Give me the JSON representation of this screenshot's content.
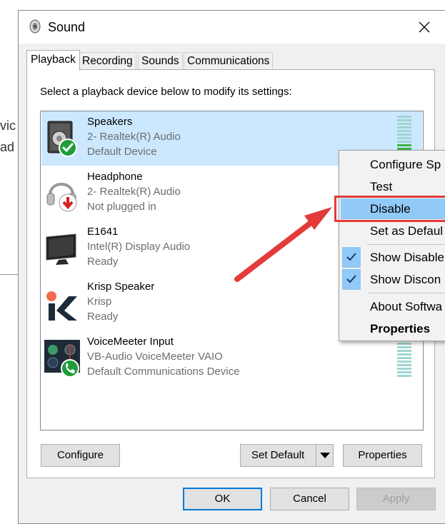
{
  "window": {
    "title": "Sound"
  },
  "background": {
    "fragments": [
      "vic",
      "ad"
    ]
  },
  "tabs": [
    {
      "label": "Playback",
      "active": true
    },
    {
      "label": "Recording",
      "active": false
    },
    {
      "label": "Sounds",
      "active": false
    },
    {
      "label": "Communications",
      "active": false
    }
  ],
  "instruction": "Select a playback device below to modify its settings:",
  "devices": [
    {
      "name": "Speakers",
      "driver": "2- Realtek(R) Audio",
      "status": "Default Device",
      "icon": "speaker-icon",
      "badge": "default-check-badge",
      "selected": true,
      "level_bars": 4
    },
    {
      "name": "Headphone",
      "driver": "2- Realtek(R) Audio",
      "status": "Not plugged in",
      "icon": "headphone-icon",
      "badge": "unplugged-arrow-badge",
      "selected": false
    },
    {
      "name": "E1641",
      "driver": "Intel(R) Display Audio",
      "status": "Ready",
      "icon": "monitor-icon",
      "selected": false
    },
    {
      "name": "Krisp Speaker",
      "driver": "Krisp",
      "status": "Ready",
      "icon": "krisp-logo-icon",
      "selected": false
    },
    {
      "name": "VoiceMeeter Input",
      "driver": "VB-Audio VoiceMeeter VAIO",
      "status": "Default Communications Device",
      "icon": "voicemeeter-icon",
      "badge": "communications-phone-badge",
      "selected": false,
      "level_bars": 0
    }
  ],
  "buttons": {
    "configure": "Configure",
    "set_default": "Set Default",
    "properties": "Properties",
    "ok": "OK",
    "cancel": "Cancel",
    "apply": "Apply"
  },
  "context_menu": {
    "items": [
      {
        "label": "Configure Sp",
        "checked": false,
        "highlighted": false,
        "bold": false
      },
      {
        "label": "Test",
        "checked": false,
        "highlighted": false,
        "bold": false
      },
      {
        "label": "Disable",
        "checked": false,
        "highlighted": true,
        "bold": false
      },
      {
        "label": "Set as Defaul",
        "checked": false,
        "highlighted": false,
        "bold": false
      },
      {
        "label": "Show Disable",
        "checked": true,
        "highlighted": false,
        "bold": false
      },
      {
        "label": "Show Discon",
        "checked": true,
        "highlighted": false,
        "bold": false
      },
      {
        "label": "About Softwa",
        "checked": false,
        "highlighted": false,
        "bold": false
      },
      {
        "label": "Properties",
        "checked": false,
        "highlighted": false,
        "bold": true
      }
    ]
  },
  "colors": {
    "selection": "#cce8ff",
    "menu_highlight": "#91c9f7",
    "annotation_red": "#e33a3a",
    "default_badge_green": "#1f9d3a",
    "unplugged_badge_red": "#d42020",
    "krisp_orange": "#f26b4f"
  }
}
